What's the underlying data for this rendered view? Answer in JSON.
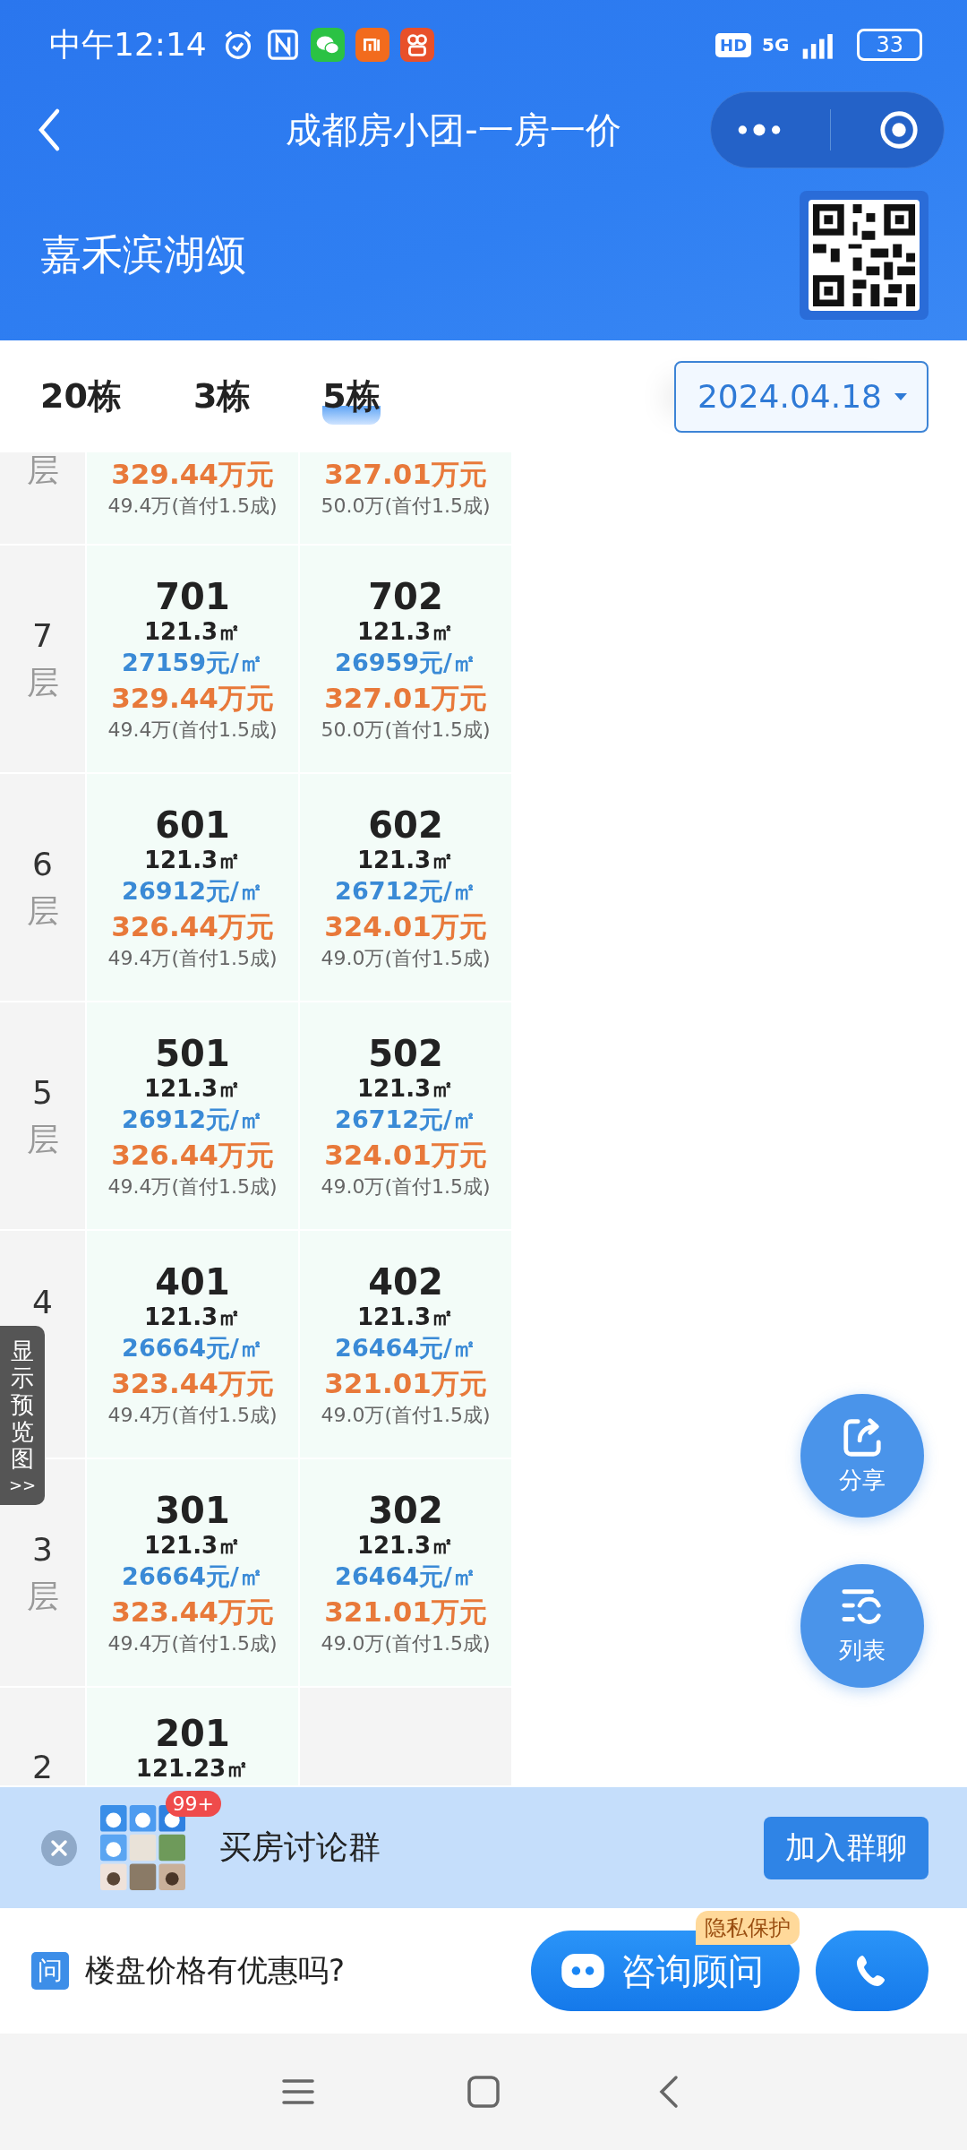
{
  "status_bar": {
    "time": "中午12:14",
    "hd": "HD",
    "network": "5G",
    "battery": "33"
  },
  "nav": {
    "title": "成都房小团-一房一价"
  },
  "project": {
    "name": "嘉禾滨湖颂"
  },
  "tabs": [
    {
      "label": "20栋",
      "selected": false
    },
    {
      "label": "3栋",
      "selected": false
    },
    {
      "label": "5栋",
      "selected": true
    }
  ],
  "date_picker": {
    "value": "2024.04.18"
  },
  "floors": [
    {
      "label": "层",
      "units": [
        {
          "kind": "unit",
          "total": "329.44万元",
          "down": "49.4万(首付1.5成)"
        },
        {
          "kind": "unit",
          "total": "327.01万元",
          "down": "50.0万(首付1.5成)"
        }
      ]
    },
    {
      "number": "7",
      "label": "层",
      "units": [
        {
          "kind": "unit",
          "room": "701",
          "area": "121.3㎡",
          "unit_price": "27159元/㎡",
          "total": "329.44万元",
          "down": "49.4万(首付1.5成)"
        },
        {
          "kind": "unit",
          "room": "702",
          "area": "121.3㎡",
          "unit_price": "26959元/㎡",
          "total": "327.01万元",
          "down": "50.0万(首付1.5成)"
        }
      ]
    },
    {
      "number": "6",
      "label": "层",
      "units": [
        {
          "kind": "unit",
          "room": "601",
          "area": "121.3㎡",
          "unit_price": "26912元/㎡",
          "total": "326.44万元",
          "down": "49.4万(首付1.5成)"
        },
        {
          "kind": "unit",
          "room": "602",
          "area": "121.3㎡",
          "unit_price": "26712元/㎡",
          "total": "324.01万元",
          "down": "49.0万(首付1.5成)"
        }
      ]
    },
    {
      "number": "5",
      "label": "层",
      "units": [
        {
          "kind": "unit",
          "room": "501",
          "area": "121.3㎡",
          "unit_price": "26912元/㎡",
          "total": "326.44万元",
          "down": "49.4万(首付1.5成)"
        },
        {
          "kind": "unit",
          "room": "502",
          "area": "121.3㎡",
          "unit_price": "26712元/㎡",
          "total": "324.01万元",
          "down": "49.0万(首付1.5成)"
        }
      ]
    },
    {
      "number": "4",
      "units": [
        {
          "kind": "unit",
          "room": "401",
          "area": "121.3㎡",
          "unit_price": "26664元/㎡",
          "total": "323.44万元",
          "down": "49.4万(首付1.5成)"
        },
        {
          "kind": "unit",
          "room": "402",
          "area": "121.3㎡",
          "unit_price": "26464元/㎡",
          "total": "321.01万元",
          "down": "49.0万(首付1.5成)"
        }
      ]
    },
    {
      "number": "3",
      "label": "层",
      "units": [
        {
          "kind": "unit",
          "room": "301",
          "area": "121.3㎡",
          "unit_price": "26664元/㎡",
          "total": "323.44万元",
          "down": "49.4万(首付1.5成)"
        },
        {
          "kind": "unit",
          "room": "302",
          "area": "121.3㎡",
          "unit_price": "26464元/㎡",
          "total": "321.01万元",
          "down": "49.0万(首付1.5成)"
        }
      ]
    },
    {
      "number": "2",
      "units": [
        {
          "kind": "unit",
          "room": "201",
          "area": "121.23㎡"
        },
        {
          "kind": "empty"
        }
      ]
    }
  ],
  "preview_tab": {
    "label": "显示预览图",
    "arrow": ">>"
  },
  "float_buttons": [
    {
      "kind": "share",
      "label": "分享"
    },
    {
      "kind": "list",
      "label": "列表"
    }
  ],
  "group_banner": {
    "badge": "99+",
    "title": "买房讨论群",
    "button": "加入群聊"
  },
  "consult_bar": {
    "icon_text": "问",
    "question": "楼盘价格有优惠吗?",
    "button": "咨询顾问",
    "tag": "隐私保护"
  }
}
